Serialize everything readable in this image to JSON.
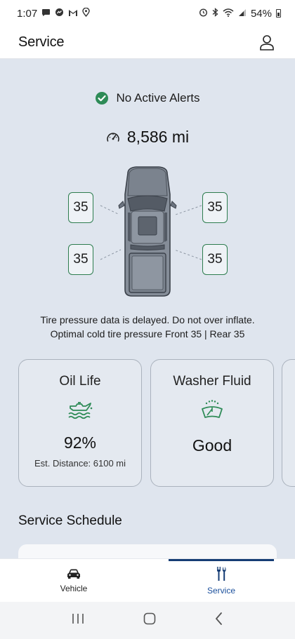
{
  "status_bar": {
    "time": "1:07",
    "battery_percent": "54%",
    "left_icons": [
      "message-icon",
      "messenger-icon",
      "gmail-icon",
      "location-icon"
    ],
    "right_icons": [
      "alarm-icon",
      "bluetooth-icon",
      "wifi-icon",
      "signal-icon",
      "battery-icon"
    ]
  },
  "header": {
    "title": "Service",
    "profile_icon": "person-icon"
  },
  "alerts": {
    "text": "No Active Alerts",
    "status_color": "#2e8b57"
  },
  "odometer": {
    "value": "8,586 mi",
    "icon": "speedometer-icon"
  },
  "tires": {
    "front_left": "35",
    "front_right": "35",
    "rear_left": "35",
    "rear_right": "35",
    "border_color": "#2e7d4f"
  },
  "tire_note": {
    "line1": "Tire pressure data is delayed. Do not over inflate.",
    "line2": "Optimal cold tire pressure Front 35 | Rear 35"
  },
  "cards": {
    "oil": {
      "title": "Oil Life",
      "icon": "oil-can-icon",
      "value": "92%",
      "sub": "Est. Distance: 6100 mi"
    },
    "washer": {
      "title": "Washer Fluid",
      "icon": "washer-fluid-icon",
      "value": "Good"
    }
  },
  "schedule": {
    "title": "Service Schedule"
  },
  "bottom_nav": {
    "vehicle_label": "Vehicle",
    "service_label": "Service",
    "active_tab": "Service",
    "accent_color": "#153c74"
  },
  "system_nav": {
    "icons": [
      "recents-icon",
      "home-icon",
      "back-icon"
    ]
  }
}
